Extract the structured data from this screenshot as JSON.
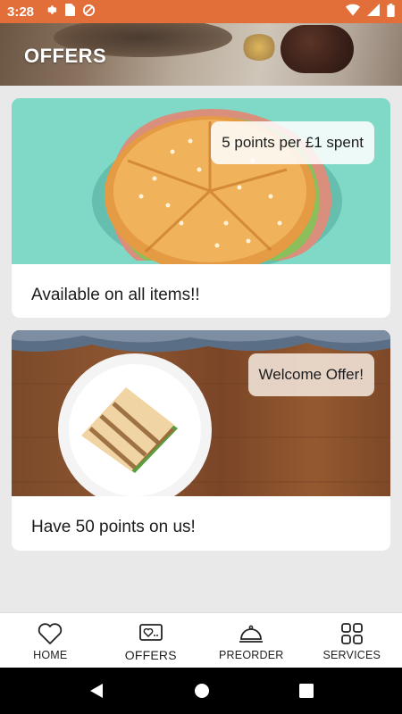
{
  "status_bar": {
    "time": "3:28",
    "left_icons": [
      "gear-icon",
      "sim-card-icon",
      "data-saver-icon"
    ],
    "right_icons": [
      "wifi-icon",
      "signal-icon",
      "battery-icon"
    ]
  },
  "header": {
    "title": "OFFERS"
  },
  "offers": [
    {
      "badge": "5 points per £1 spent",
      "caption": "Available on all items!!",
      "image": "bagel-sandwich"
    },
    {
      "badge": "Welcome Offer!",
      "caption": "Have 50 points on us!",
      "image": "grilled-sandwich"
    }
  ],
  "bottom_nav": {
    "items": [
      {
        "label": "HOME",
        "icon": "heart-icon"
      },
      {
        "label": "OFFERS",
        "icon": "offers-heart-card-icon",
        "active": true
      },
      {
        "label": "PREORDER",
        "icon": "service-bell-icon"
      },
      {
        "label": "SERVICES",
        "icon": "grid-icon"
      }
    ]
  },
  "system_nav": {
    "buttons": [
      "back-icon",
      "home-circle-icon",
      "recents-icon"
    ]
  },
  "colors": {
    "status_bar": "#e26f3a",
    "background": "#e9e9e9",
    "card": "#ffffff",
    "nav_bar": "#ffffff",
    "system_nav": "#000000"
  }
}
